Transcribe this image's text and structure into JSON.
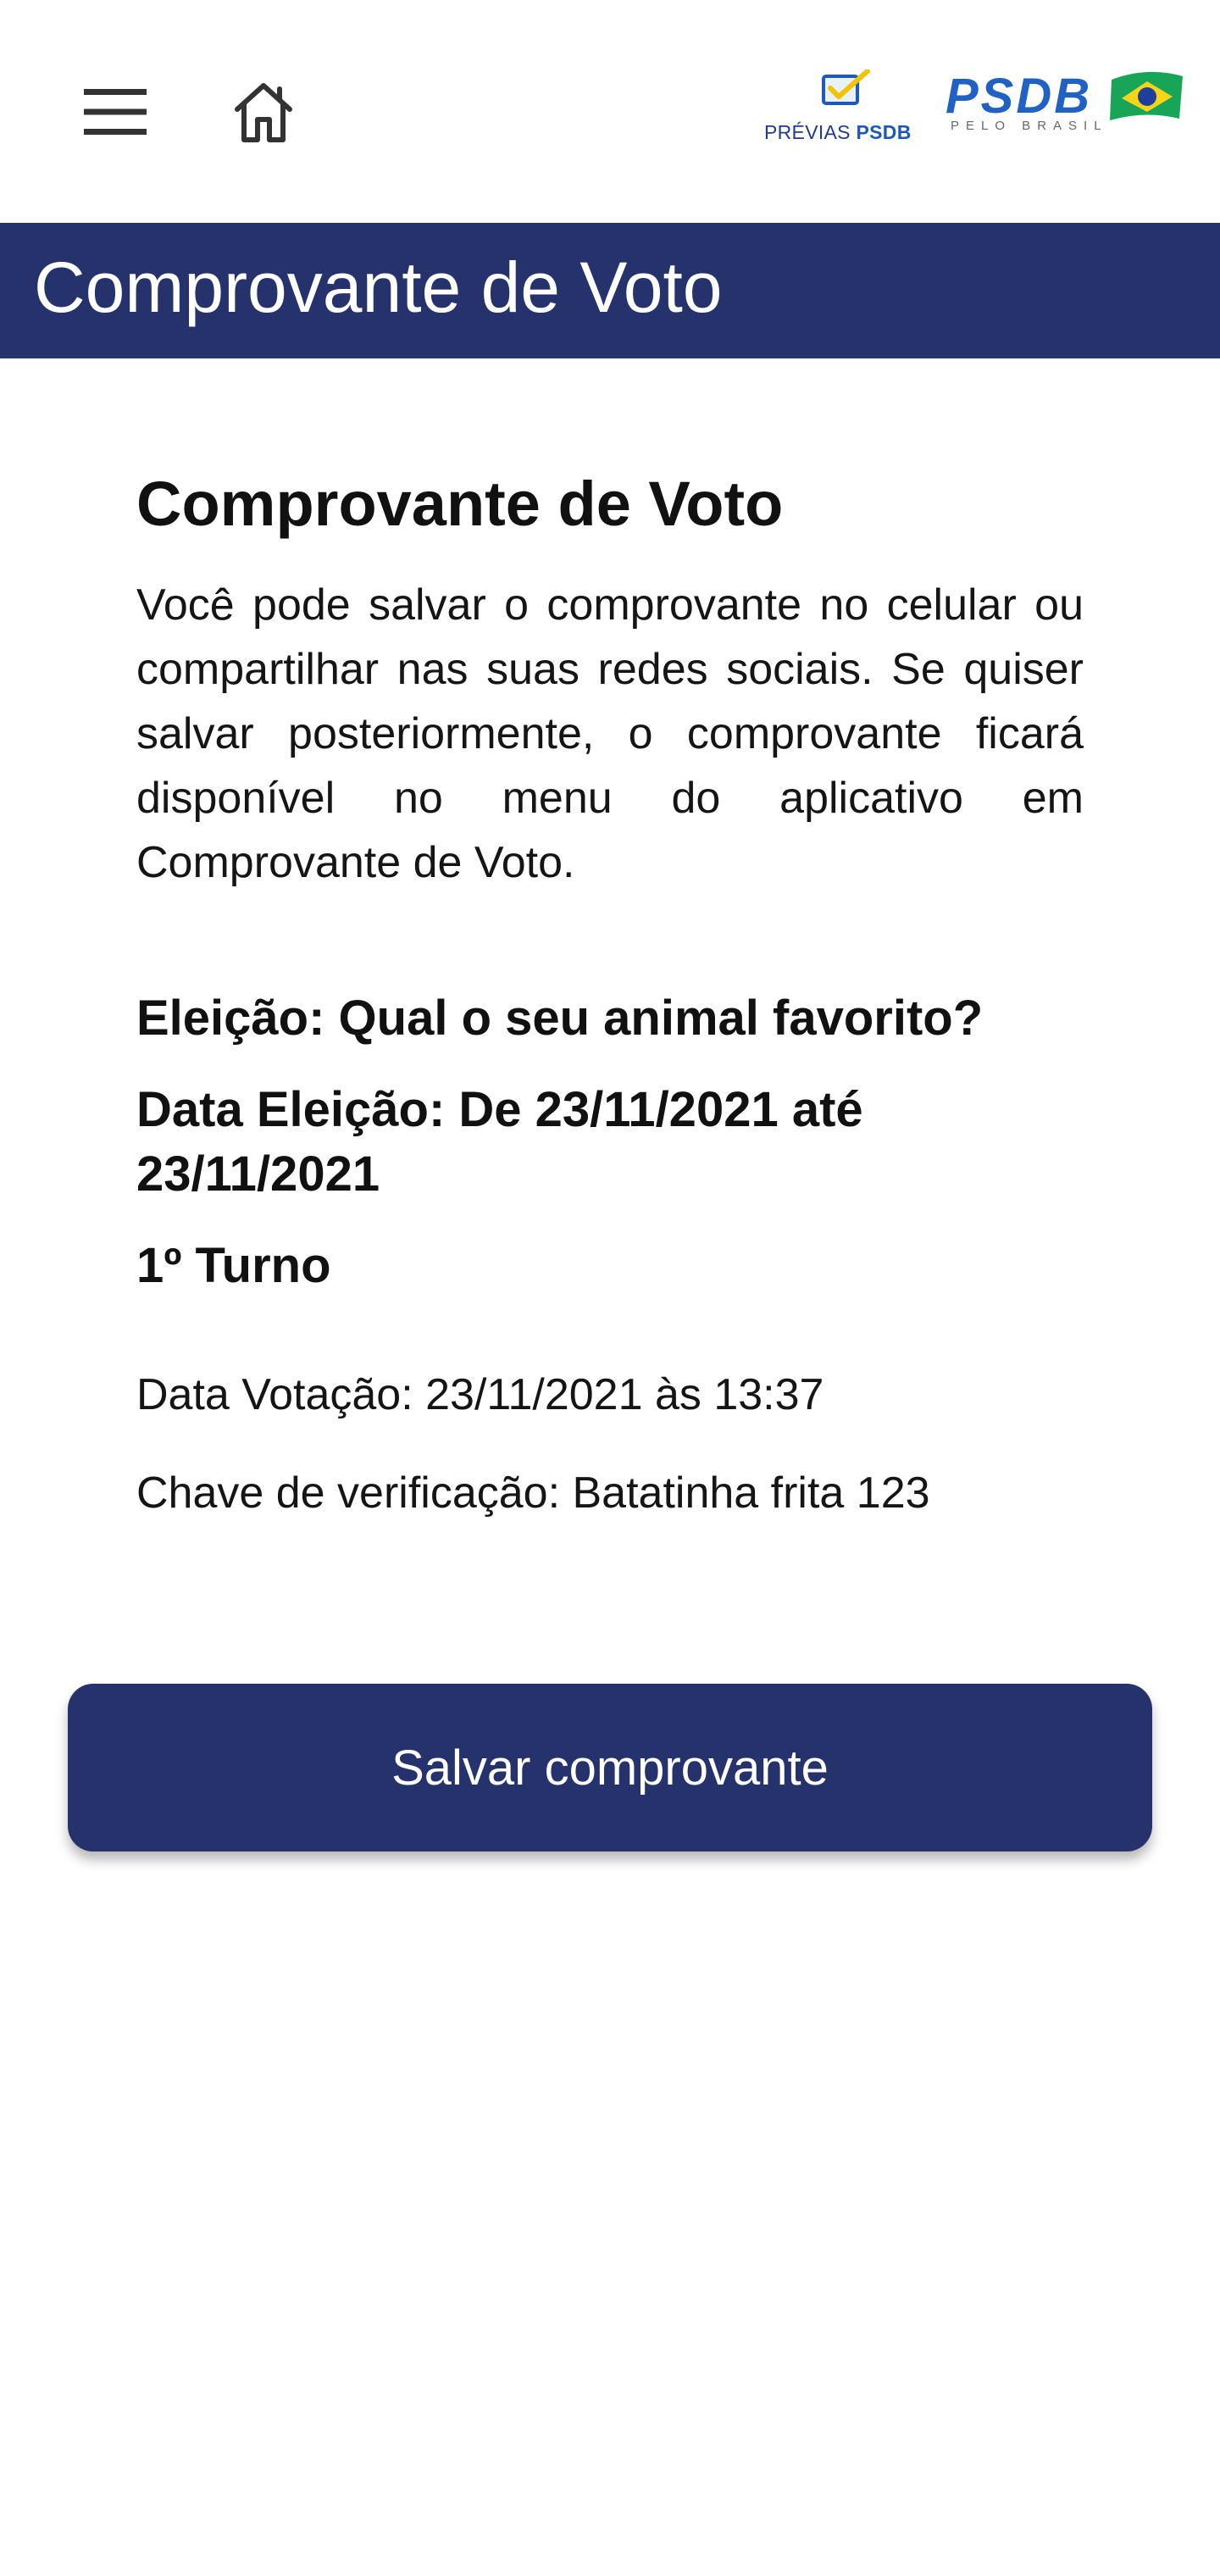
{
  "header": {
    "menu_icon": "hamburger-menu-icon",
    "home_icon": "home-icon",
    "logo_previas": {
      "prefix": "PRÉVIAS",
      "brand": "PSDB"
    },
    "logo_psdb": {
      "word": "PSDB",
      "tagline": "PELO BRASIL"
    }
  },
  "page": {
    "title": "Comprovante de Voto"
  },
  "content": {
    "heading": "Comprovante de Voto",
    "description": "Você pode salvar o comprovante no celular ou compartilhar nas suas redes sociais. Se quiser salvar posteriormente, o comprovante ficará disponível no menu do aplicativo em Comprovante de Voto.",
    "election_line": "Eleição: Qual o seu animal favorito?",
    "election_date_line": "Data Eleição: De 23/11/2021 até 23/11/2021",
    "round_line": "1º Turno",
    "vote_date_line": "Data Votação: 23/11/2021 às 13:37",
    "verification_line": "Chave de verificação: Batatinha frita 123"
  },
  "actions": {
    "save_label": "Salvar comprovante"
  },
  "colors": {
    "primary": "#25326b",
    "background": "#ffffff",
    "text": "#111111"
  }
}
